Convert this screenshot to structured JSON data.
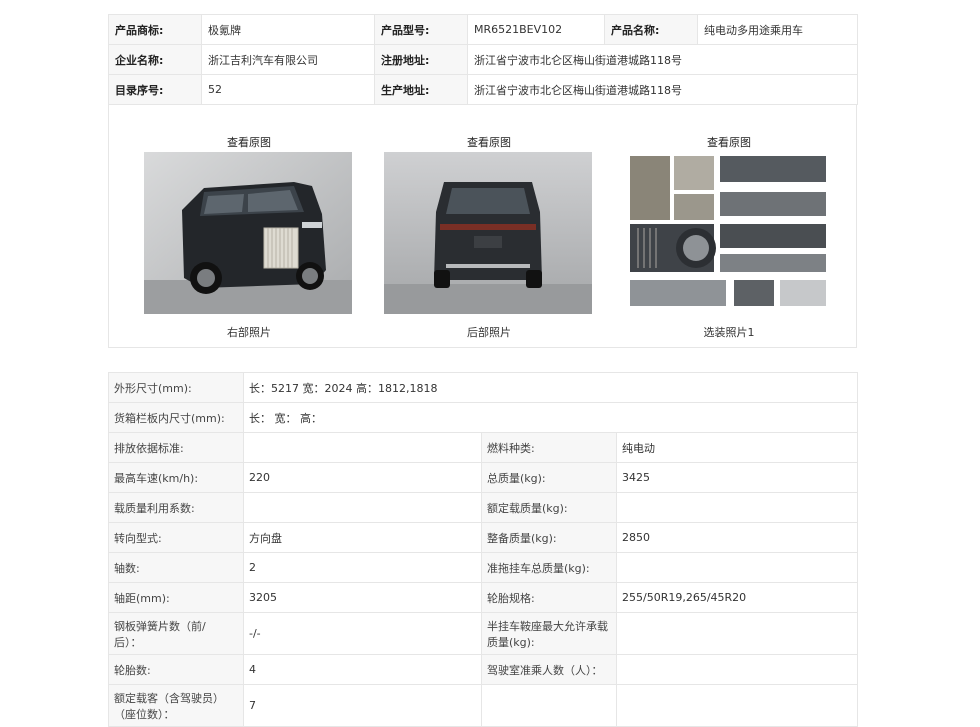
{
  "info": {
    "brand_label": "产品商标:",
    "brand": "极氪牌",
    "model_label": "产品型号:",
    "model": "MR6521BEV102",
    "name_label": "产品名称:",
    "name": "纯电动多用途乘用车",
    "company_label": "企业名称:",
    "company": "浙江吉利汽车有限公司",
    "reg_addr_label": "注册地址:",
    "reg_addr": "浙江省宁波市北仑区梅山街道港城路118号",
    "catalog_label": "目录序号:",
    "catalog": "52",
    "prod_addr_label": "生产地址:",
    "prod_addr": "浙江省宁波市北仑区梅山街道港城路118号"
  },
  "photos": [
    {
      "view_label": "查看原图",
      "caption": "右部照片"
    },
    {
      "view_label": "查看原图",
      "caption": "后部照片"
    },
    {
      "view_label": "查看原图",
      "caption": "选装照片1"
    }
  ],
  "specs": {
    "dims_label": "外形尺寸(mm):",
    "dims": "长：5217 宽：2024 高：1812,1818",
    "cargo_label": "货箱栏板内尺寸(mm):",
    "cargo": "长：  宽：  高：",
    "emission_label": "排放依据标准:",
    "emission": "",
    "fuel_label": "燃料种类:",
    "fuel": "纯电动",
    "speed_label": "最高车速(km/h):",
    "speed": "220",
    "total_mass_label": "总质量(kg):",
    "total_mass": "3425",
    "load_coef_label": "载质量利用系数:",
    "load_coef": "",
    "rated_load_label": "额定载质量(kg):",
    "rated_load": "",
    "steering_label": "转向型式:",
    "steering": "方向盘",
    "curb_label": "整备质量(kg):",
    "curb": "2850",
    "axles_label": "轴数:",
    "axles": "2",
    "trailer_label": "准拖挂车总质量(kg):",
    "trailer": "",
    "wheelbase_label": "轴距(mm):",
    "wheelbase": "3205",
    "tire_spec_label": "轮胎规格:",
    "tire_spec": "255/50R19,265/45R20",
    "leaf_label_1": "钢板弹簧片数（前/",
    "leaf_label_2": "后）：",
    "leaf": "-/-",
    "semi_label_1": "半挂车鞍座最大允许承载",
    "semi_label_2": "质量(kg):",
    "semi": "",
    "tires_label": "轮胎数:",
    "tires": "4",
    "cab_label": "驾驶室准乘人数（人）：",
    "cab": "",
    "seats_label_1": "额定载客（含驾驶员）",
    "seats_label_2": "（座位数）：",
    "seats": "7"
  }
}
